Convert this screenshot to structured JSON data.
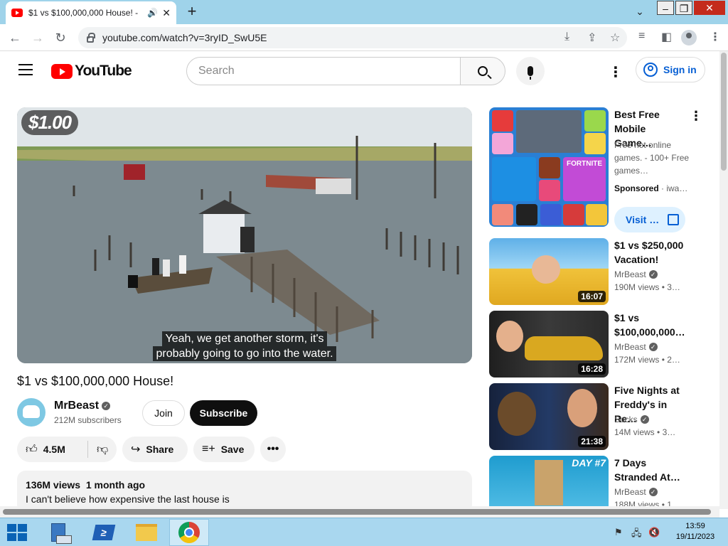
{
  "browser": {
    "tab_title": "$1 vs $100,000,000 House! -",
    "tab_audio_icon": "speaker-icon",
    "url": "youtube.com/watch?v=3ryID_SwU5E"
  },
  "youtube": {
    "logo_text": "YouTube",
    "search_placeholder": "Search",
    "sign_in": "Sign in"
  },
  "video": {
    "overlay_badge": "$1.00",
    "caption_line1": "Yeah, we get another storm, it's",
    "caption_line2": "probably going to go into the water.",
    "title": "$1 vs $100,000,000 House!",
    "channel": "MrBeast",
    "subscribers": "212M subscribers",
    "join": "Join",
    "subscribe": "Subscribe",
    "likes": "4.5M",
    "share": "Share",
    "save": "Save",
    "views": "136M views",
    "age": "1 month ago",
    "description": "I can't believe how expensive the last house is"
  },
  "ad": {
    "title": "Best Free Mobile Game…",
    "description": "Free hot online games. - 100+ Free games…",
    "sponsored": "Sponsored",
    "advertiser": "iwa…",
    "visit": "Visit …",
    "thumb_text": "FORTNITE"
  },
  "sidebar": [
    {
      "title": "$1 vs $250,000 Vacation!",
      "channel": "MrBeast",
      "verified": true,
      "views": "190M views",
      "age": "• 3…",
      "duration": "16:07",
      "thumb_colors": [
        "#5fb0e8",
        "#f0c23a"
      ]
    },
    {
      "title": "$1 vs $100,000,000…",
      "channel": "MrBeast",
      "verified": true,
      "views": "172M views",
      "age": "• 2…",
      "duration": "16:28",
      "thumb_colors": [
        "#2b2b2b",
        "#d9a820"
      ]
    },
    {
      "title": "Five Nights at Freddy's in Re…",
      "channel": "Socks",
      "verified": true,
      "views": "14M views",
      "age": "• 3…",
      "duration": "21:38",
      "thumb_colors": [
        "#1a2a4a",
        "#6b4b2a"
      ]
    },
    {
      "title": "7 Days Stranded At…",
      "channel": "MrBeast",
      "verified": true,
      "views": "188M views",
      "age": "• 1…",
      "duration": "",
      "thumb_text": "DAY #7",
      "thumb_colors": [
        "#1f9ccf",
        "#7ed6f2"
      ]
    }
  ],
  "taskbar": {
    "time": "13:59",
    "date": "19/11/2023"
  },
  "colors": {
    "accent_red": "#ff0000",
    "link_blue": "#065fd4",
    "tabbar": "#9fd3ea",
    "taskbar": "#a9d7ef"
  }
}
